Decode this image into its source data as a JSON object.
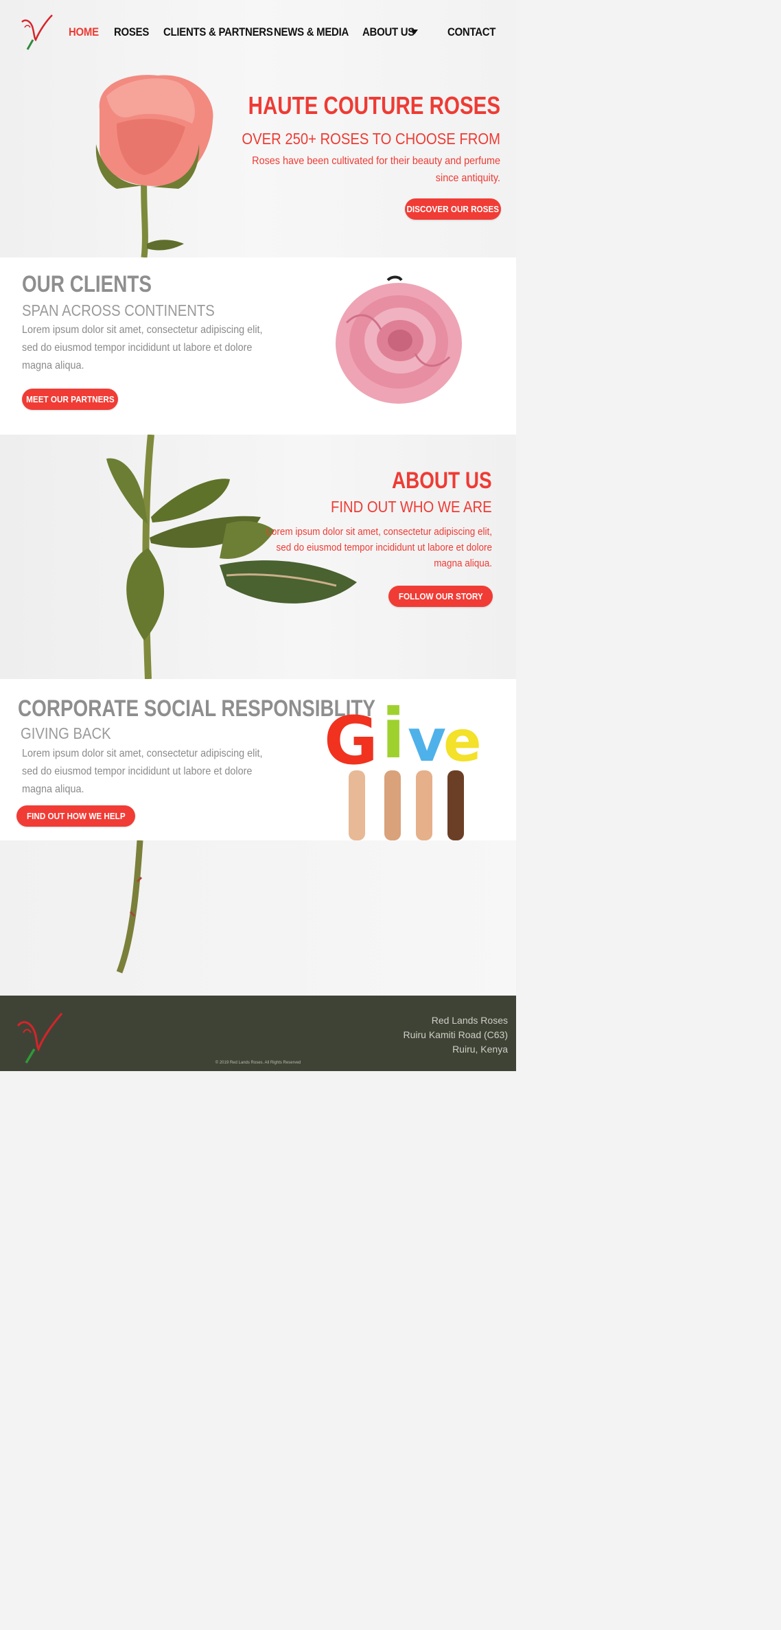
{
  "nav": {
    "items": [
      {
        "label": "HOME",
        "active": true
      },
      {
        "label": "ROSES"
      },
      {
        "label": "CLIENTS & PARTNERS"
      },
      {
        "label": "NEWS & MEDIA"
      },
      {
        "label": "ABOUT US"
      },
      {
        "label": "CONTACT"
      }
    ]
  },
  "hero": {
    "title": "HAUTE COUTURE ROSES",
    "subtitle": "OVER 250+ ROSES TO CHOOSE FROM",
    "text_line1": "Roses have been cultivated for their beauty and perfume",
    "text_line2": "since antiquity.",
    "button": "DISCOVER OUR ROSES"
  },
  "clients": {
    "title": "OUR CLIENTS",
    "subtitle": "SPAN ACROSS CONTINENTS",
    "text_line1": "Lorem ipsum dolor sit amet, consectetur adipiscing elit,",
    "text_line2": " sed do eiusmod tempor incididunt ut labore et dolore",
    "text_line3": "magna aliqua.",
    "button": "MEET OUR PARTNERS"
  },
  "about": {
    "title": "ABOUT US",
    "subtitle": "FIND OUT WHO WE ARE",
    "text_line1": "Lorem ipsum dolor sit amet, consectetur adipiscing elit,",
    "text_line2": "sed do eiusmod tempor incididunt ut labore et dolore",
    "text_line3": "magna aliqua.",
    "button": "FOLLOW OUR STORY"
  },
  "csr": {
    "title": "CORPORATE SOCIAL RESPONSIBLITY",
    "subtitle": "GIVING BACK",
    "text_line1": "Lorem ipsum dolor sit amet, consectetur adipiscing elit,",
    "text_line2": " sed do eiusmod tempor incididunt ut labore et dolore",
    "text_line3": "magna aliqua.",
    "button": "FIND OUT HOW WE HELP",
    "give_letters": [
      "G",
      "i",
      "v",
      "e"
    ]
  },
  "footer": {
    "company": "Red Lands Roses",
    "address1": "Ruiru Kamiti Road (C63)",
    "address2": "Ruiru, Kenya",
    "copyright": "© 2019 Red Lands Roses. All Rights Reserved"
  },
  "colors": {
    "accent": "#ee3b34",
    "footer_bg": "#3f4336",
    "heading_gray": "#8e8e8e"
  }
}
